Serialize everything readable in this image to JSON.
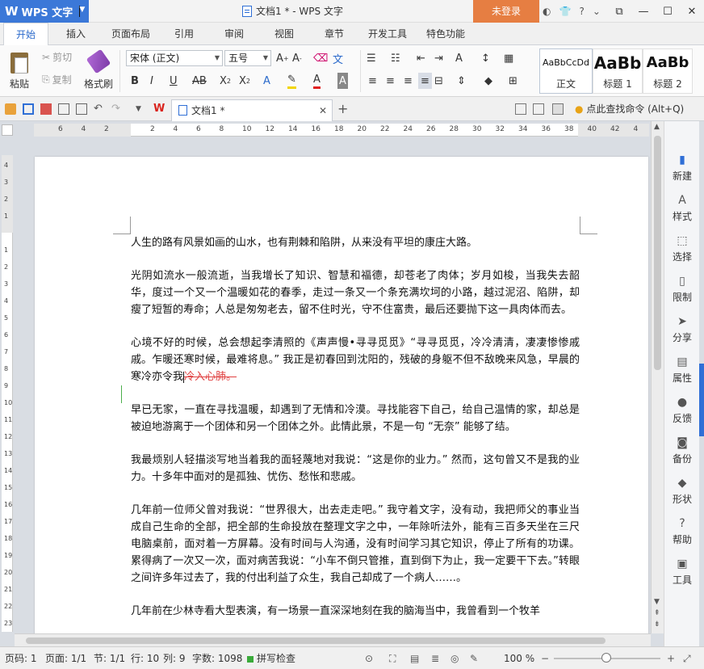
{
  "app": {
    "name": "WPS 文字",
    "window_title": "文档1 * - WPS 文字",
    "login_label": "未登录",
    "accent": "#3b78d8",
    "login_color": "#e67e42"
  },
  "menu_tabs": [
    "开始",
    "插入",
    "页面布局",
    "引用",
    "审阅",
    "视图",
    "章节",
    "开发工具",
    "特色功能"
  ],
  "ribbon": {
    "paste": "粘贴",
    "cut": "剪切",
    "copy": "复制",
    "format_painter": "格式刷",
    "font_name": "宋体 (正文)",
    "font_size": "五号",
    "styles": [
      {
        "sample": "AaBbCcDd",
        "label": "正文"
      },
      {
        "sample": "AaBb",
        "label": "标题 1"
      },
      {
        "sample": "AaBb",
        "label": "标题 2"
      }
    ]
  },
  "quick_bar": {
    "doc_tab": "文档1 *",
    "search_cmd": "点此查找命令 (Alt+Q)"
  },
  "ruler": {
    "h_ticks": [
      "6",
      "4",
      "2",
      "",
      "2",
      "4",
      "6",
      "8",
      "10",
      "12",
      "14",
      "16",
      "18",
      "20",
      "22",
      "24",
      "26",
      "28",
      "30",
      "32",
      "34",
      "36",
      "38",
      "40",
      "42",
      "4"
    ],
    "v_ticks": [
      "4",
      "3",
      "2",
      "1",
      "",
      "1",
      "2",
      "3",
      "4",
      "5",
      "6",
      "7",
      "8",
      "9",
      "10",
      "11",
      "12",
      "13",
      "14",
      "15",
      "16",
      "17",
      "18",
      "19",
      "20",
      "21",
      "22",
      "23"
    ]
  },
  "document": {
    "paragraphs": [
      "人生的路有风景如画的山水，也有荆棘和陷阱，从来没有平坦的康庄大路。",
      "光阴如流水一般流逝，当我增长了知识、智慧和福德，却苍老了肉体；岁月如梭，当我失去韶华，度过一个又一个温暖如花的春季，走过一条又一个条充满坎坷的小路，越过泥沼、陷阱，却瘦了短暂的寿命；人总是匆匆老去，留不住时光，守不住富贵，最后还要抛下这一具肉体而去。",
      "心境不好的时候，总会想起李清照的《声声慢•寻寻觅觅》“寻寻觅觅，冷冷清清，凄凄惨惨戚戚。乍暖还寒时候，最难将息。”  我正是初春回到沈阳的，残破的身躯不但不敌晚来风急，早晨的寒冷亦令我",
      "早已无家，一直在寻找温暖，却遇到了无情和冷漠。寻找能容下自己，给自己温情的家，却总是被迫地游离于一个团体和另一个团体之外。此情此景，不是一句 “无奈” 能够了结。",
      "我最烦别人轻描淡写地当着我的面轻蔑地对我说：“这是你的业力。” 然而，这句曾又不是我的业力。十多年中面对的是孤独、忧伤、愁怅和悲戚。",
      "几年前一位师父曾对我说：“世界很大，出去走走吧。” 我守着文字，没有动，我把师父的事业当成自己生命的全部，把全部的生命投放在整理文字之中，一年除听法外，能有三百多天坐在三尺电脑桌前，面对着一方屏幕。没有时间与人沟通，没有时间学习其它知识，停止了所有的功课。累得病了一次又一次，面对病苦我说：“小车不倒只管推，直到倒下为止，我一定要干下去。”转眼之间许多年过去了，我的付出利益了众生，我自己却成了一个病人……。",
      "几年前在少林寺看大型表演，有一场景一直深深地刻在我的脑海当中，我曾看到一个牧羊"
    ],
    "deleted_text": "冷入心肺。"
  },
  "right_panel": [
    "新建",
    "样式",
    "选择",
    "限制",
    "分享",
    "属性",
    "反馈",
    "备份",
    "形状",
    "帮助",
    "工具"
  ],
  "status": {
    "page": "页码: 1",
    "pages": "页面: 1/1",
    "section": "节: 1/1",
    "row": "行: 10",
    "col": "列: 9",
    "words": "字数: 1098",
    "spell": "拼写检查",
    "zoom": "100 %"
  }
}
